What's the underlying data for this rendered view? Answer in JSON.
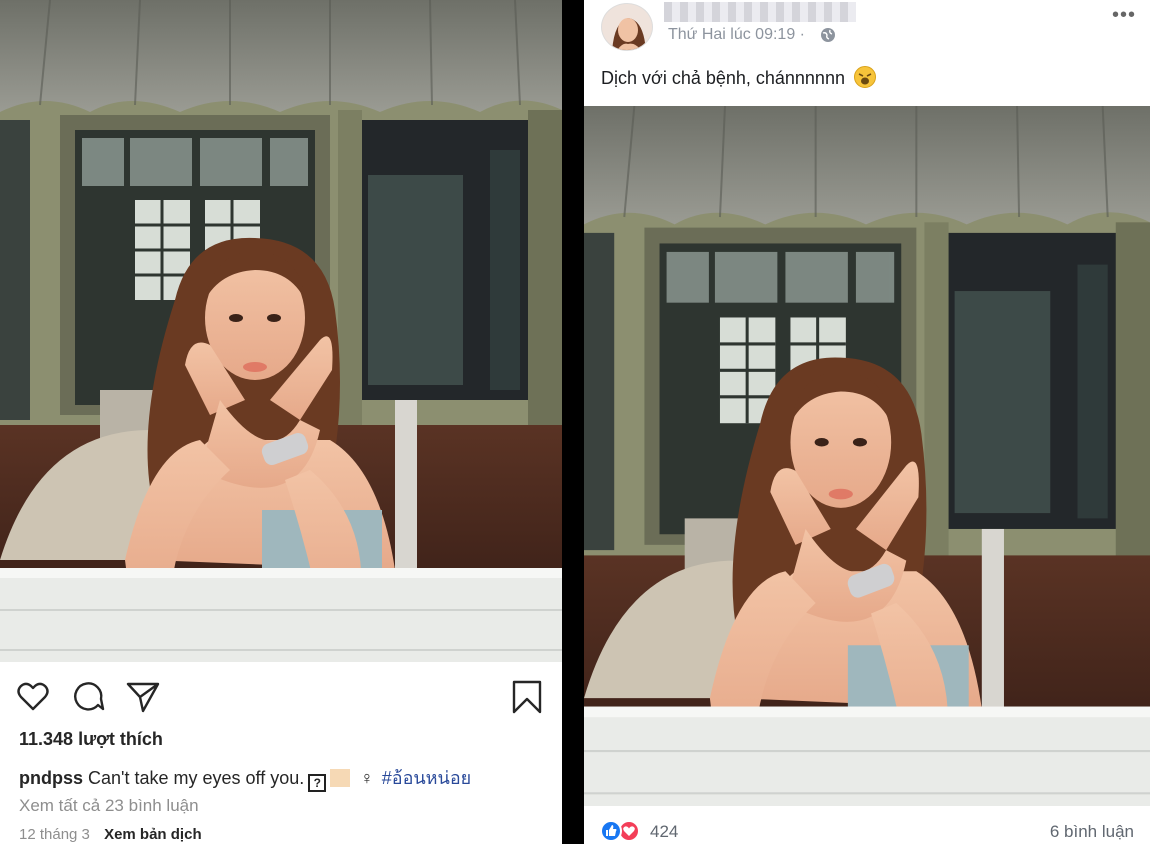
{
  "instagram": {
    "likes": "11.348 lượt thích",
    "caption": {
      "username": "pndpss",
      "text": "Can't take my eyes off you.",
      "glyph": "?",
      "venus": "♀",
      "hashtag": "#อ้อนหน่อย"
    },
    "view_comments": "Xem tất cả 23 bình luận",
    "date": "12 tháng 3",
    "translate": "Xem bản dịch",
    "icons": [
      "heart-icon",
      "comment-icon",
      "share-icon",
      "bookmark-icon"
    ]
  },
  "facebook": {
    "timestamp": "Thứ Hai lúc 09:19 ·",
    "post_text": "Dịch với chả bệnh, chánnnnnn",
    "more": "•••",
    "reaction_count": "424",
    "comment_count": "6 bình luận",
    "colors": {
      "like": "#1877f2",
      "love": "#f33e58"
    }
  }
}
